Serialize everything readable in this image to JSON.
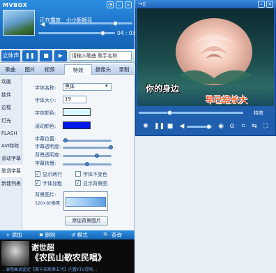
{
  "app": {
    "title": "MVBOX"
  },
  "player": {
    "now_playing_label": "正在播放",
    "now_playing_song": "小小新娘花",
    "time": "04 : 03"
  },
  "controls": {
    "stereo_label": "立体声",
    "search_placeholder": "请输入歌曲 歌手名称"
  },
  "tabs": [
    "歌曲",
    "图片",
    "视频",
    "特效",
    "摄像头",
    "录制"
  ],
  "sidebar": [
    "动画",
    "挂件",
    "边框",
    "灯光",
    "FLASH",
    "AVI特效",
    "滚动字幕",
    "歌词字幕",
    "新建列表"
  ],
  "lyric_settings": {
    "font_name_label": "字体名称:",
    "font_name_value": "黑体",
    "font_size_label": "字体大小:",
    "font_size_value": "19",
    "font_color_label": "字体颜色:",
    "font_color": "#d8f8ff",
    "scroll_color_label": "滚动颜色:",
    "scroll_color": "#0018e8",
    "pos_label": "字幕位置:",
    "transparency_label": "字幕透明度:",
    "bg_transparency_label": "背景透明度:",
    "speed_label": "字幕快慢:",
    "checkboxes": [
      {
        "label": "显示两行",
        "checked": true
      },
      {
        "label": "字体不变色",
        "checked": false
      },
      {
        "label": "字体加粗",
        "checked": true
      },
      {
        "label": "显示背景图",
        "checked": true
      }
    ],
    "bg_image_label": "背景图片:",
    "bg_image_size": "320×80像素",
    "add_bg_button": "添加背景图片"
  },
  "footer": {
    "add": "+ 添加",
    "delete": "✖ 删除",
    "mode": "↺ 模式",
    "find": "🔍 查询"
  },
  "banner": {
    "artist": "谢世超",
    "title": "《农民山歌农民唱》",
    "ticker": "…演唱曲调鉴定【赛卡拉斯第五代】内置KTV混响…"
  },
  "video": {
    "lyric_line1": "你的身边",
    "lyric_line2": "早已经长大",
    "effect_label": "特效"
  }
}
